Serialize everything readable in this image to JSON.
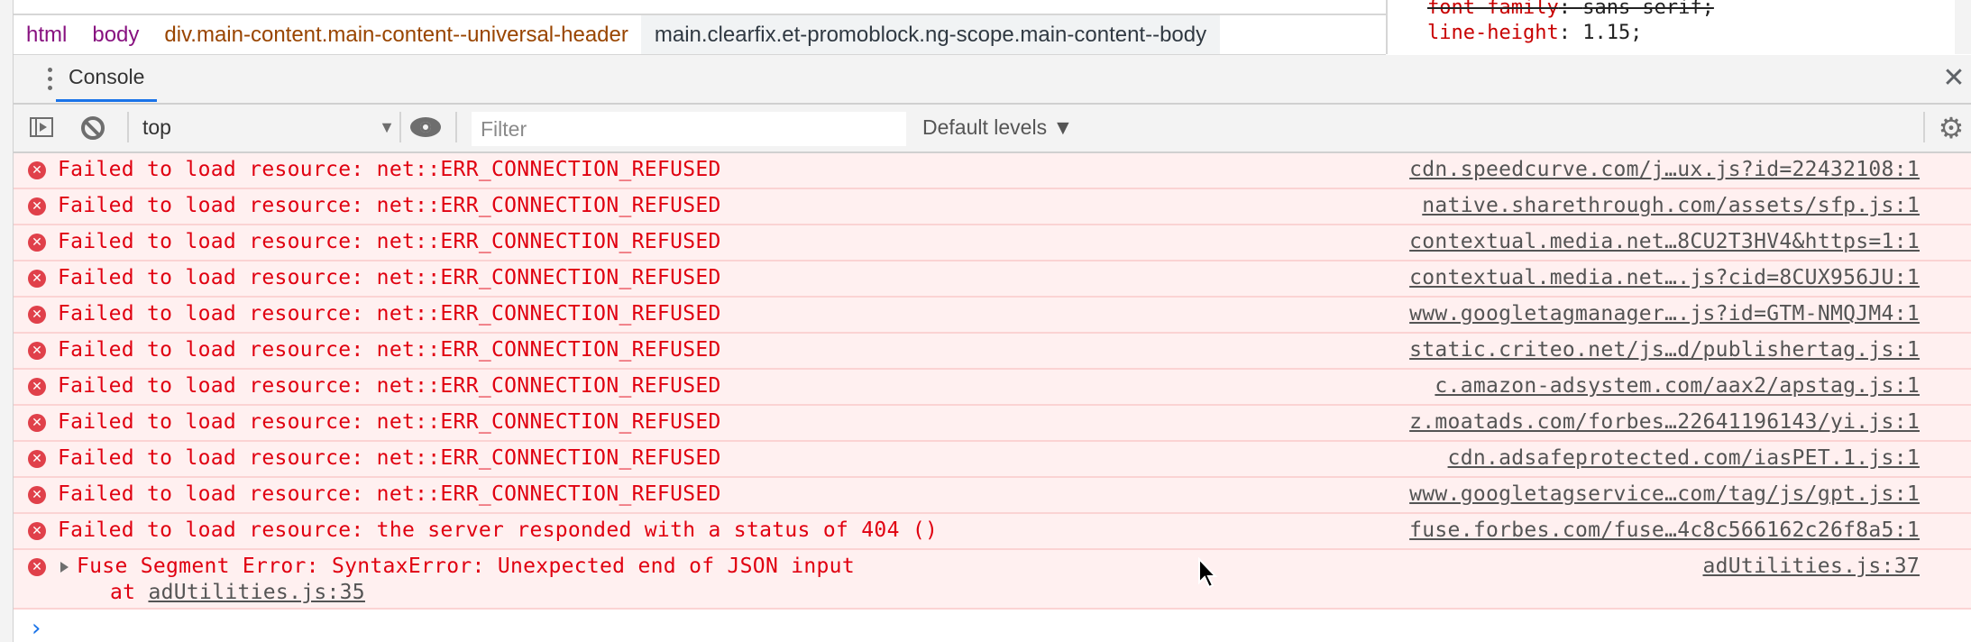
{
  "breadcrumb": {
    "items": [
      {
        "label": "html",
        "kind": "tag"
      },
      {
        "label": "body",
        "kind": "tag"
      },
      {
        "label": "div.main-content.main-content--universal-header",
        "kind": "cls"
      },
      {
        "label": "main.clearfix.et-promoblock.ng-scope.main-content--body",
        "kind": "selected"
      }
    ]
  },
  "styles": {
    "lines": [
      {
        "prop": "font-family",
        "value": "sans-serif;",
        "overridden": true
      },
      {
        "prop": "line-height",
        "value": "1.15;",
        "overridden": false
      }
    ]
  },
  "drawer": {
    "tab_label": "Console",
    "close_icon": "close-icon",
    "menu_icon": "kebab-menu-icon"
  },
  "toolbar": {
    "sidebar_icon": "sidebar-toggle-icon",
    "clear_icon": "clear-console-icon",
    "context_value": "top",
    "live_expression_icon": "eye-icon",
    "filter_placeholder": "Filter",
    "filter_value": "",
    "levels_label": "Default levels ▼",
    "settings_icon": "gear-icon"
  },
  "messages": [
    {
      "text": "Failed to load resource: net::ERR_CONNECTION_REFUSED",
      "source": "cdn.speedcurve.com/j…ux.js?id=22432108:1"
    },
    {
      "text": "Failed to load resource: net::ERR_CONNECTION_REFUSED",
      "source": "native.sharethrough.com/assets/sfp.js:1"
    },
    {
      "text": "Failed to load resource: net::ERR_CONNECTION_REFUSED",
      "source": "contextual.media.net…8CU2T3HV4&https=1:1"
    },
    {
      "text": "Failed to load resource: net::ERR_CONNECTION_REFUSED",
      "source": "contextual.media.net….js?cid=8CUX956JU:1"
    },
    {
      "text": "Failed to load resource: net::ERR_CONNECTION_REFUSED",
      "source": "www.googletagmanager….js?id=GTM-NMQJM4:1"
    },
    {
      "text": "Failed to load resource: net::ERR_CONNECTION_REFUSED",
      "source": "static.criteo.net/js…d/publishertag.js:1"
    },
    {
      "text": "Failed to load resource: net::ERR_CONNECTION_REFUSED",
      "source": "c.amazon-adsystem.com/aax2/apstag.js:1"
    },
    {
      "text": "Failed to load resource: net::ERR_CONNECTION_REFUSED",
      "source": "z.moatads.com/forbes…22641196143/yi.js:1"
    },
    {
      "text": "Failed to load resource: net::ERR_CONNECTION_REFUSED",
      "source": "cdn.adsafeprotected.com/iasPET.1.js:1"
    },
    {
      "text": "Failed to load resource: net::ERR_CONNECTION_REFUSED",
      "source": "www.googletagservice…com/tag/js/gpt.js:1"
    },
    {
      "text": "Failed to load resource: the server responded with a status of 404 ()",
      "source": "fuse.forbes.com/fuse…4c8c566162c26f8a5:1"
    }
  ],
  "expandable_message": {
    "text": "Fuse Segment Error: SyntaxError: Unexpected end of JSON input",
    "stack_prefix": "at",
    "stack_link": "adUtilities.js:35",
    "source": "adUtilities.js:37"
  },
  "prompt": {
    "caret": "›",
    "value": ""
  },
  "colors": {
    "error_text": "#e00010",
    "error_bg": "#fff0f0",
    "accent": "#1a73e8"
  }
}
